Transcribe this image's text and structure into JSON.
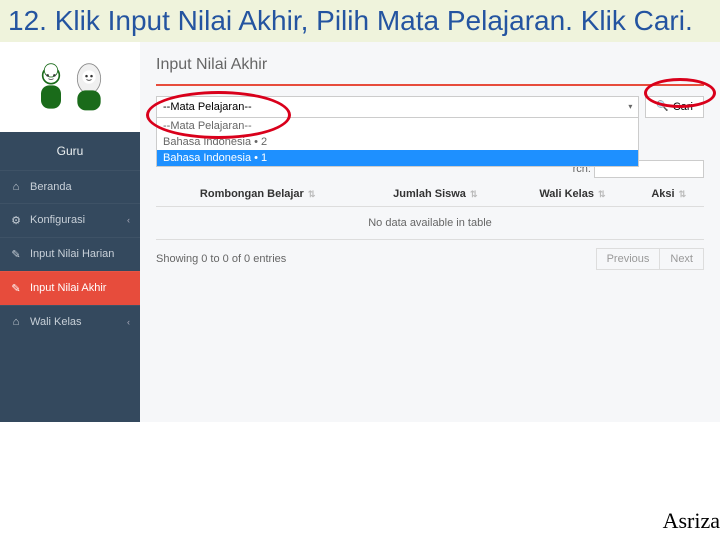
{
  "instruction": "12. Klik Input Nilai Akhir, Pilih Mata Pelajaran. Klik Cari.",
  "sidebar": {
    "role": "Guru",
    "items": [
      {
        "label": "Beranda"
      },
      {
        "label": "Konfigurasi"
      },
      {
        "label": "Input Nilai Harian"
      },
      {
        "label": "Input Nilai Akhir"
      },
      {
        "label": "Wali Kelas"
      }
    ]
  },
  "page": {
    "title": "Input Nilai Akhir",
    "select_placeholder": "--Mata Pelajaran--",
    "options": [
      "--Mata Pelajaran--",
      "Bahasa Indonesia • 2",
      "Bahasa Indonesia • 1"
    ],
    "search_button": "Cari",
    "search_label": "rch:",
    "columns": [
      "Rombongan Belajar",
      "Jumlah Siswa",
      "Wali Kelas",
      "Aksi"
    ],
    "nodata": "No data available in table",
    "entries_info": "Showing 0 to 0 of 0 entries",
    "prev": "Previous",
    "next": "Next"
  },
  "footer": "Asriza"
}
